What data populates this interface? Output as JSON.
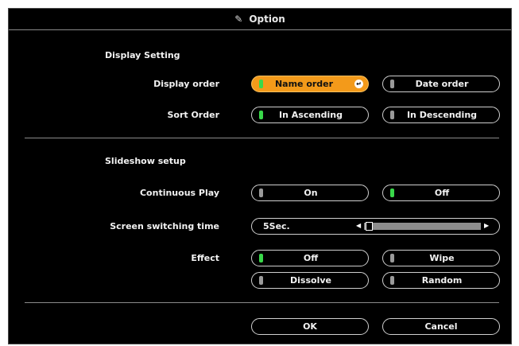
{
  "window": {
    "title": "Option"
  },
  "display_setting": {
    "heading": "Display Setting",
    "display_order": {
      "label": "Display order",
      "options": [
        {
          "label": "Name order",
          "selected": true
        },
        {
          "label": "Date order",
          "selected": false
        }
      ]
    },
    "sort_order": {
      "label": "Sort Order",
      "options": [
        {
          "label": "In Ascending",
          "selected": true
        },
        {
          "label": "In Descending",
          "selected": false
        }
      ]
    }
  },
  "slideshow": {
    "heading": "Slideshow setup",
    "continuous_play": {
      "label": "Continuous Play",
      "options": [
        {
          "label": "On",
          "selected": false
        },
        {
          "label": "Off",
          "selected": true
        }
      ]
    },
    "switching_time": {
      "label": "Screen switching time",
      "value": "5Sec.",
      "slider_position": 0
    },
    "effect": {
      "label": "Effect",
      "options": [
        {
          "label": "Off",
          "selected": true
        },
        {
          "label": "Wipe",
          "selected": false
        },
        {
          "label": "Dissolve",
          "selected": false
        },
        {
          "label": "Random",
          "selected": false
        }
      ]
    }
  },
  "footer": {
    "ok_label": "OK",
    "cancel_label": "Cancel"
  },
  "colors": {
    "highlight": "#f39a1a",
    "lamp_on": "#39d84a",
    "lamp_off": "#9a9a9a"
  }
}
